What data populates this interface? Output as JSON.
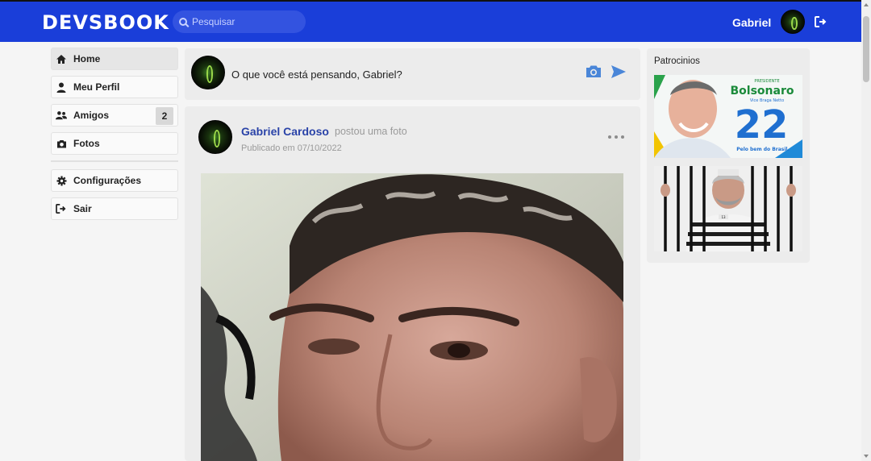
{
  "header": {
    "logo": "DEVSBOOK",
    "search_placeholder": "Pesquisar",
    "user_name": "Gabriel"
  },
  "sidebar": {
    "items": [
      {
        "label": "Home",
        "icon": "home-icon",
        "active": true
      },
      {
        "label": "Meu Perfil",
        "icon": "user-icon"
      },
      {
        "label": "Amigos",
        "icon": "friends-icon",
        "badge": "2"
      },
      {
        "label": "Fotos",
        "icon": "camera-icon"
      }
    ],
    "bottom_items": [
      {
        "label": "Configurações",
        "icon": "gear-icon"
      },
      {
        "label": "Sair",
        "icon": "logout-icon"
      }
    ]
  },
  "composer": {
    "prompt": "O que você está pensando, Gabriel?"
  },
  "post": {
    "author": "Gabriel Cardoso",
    "action": "postou uma foto",
    "date": "Publicado em 07/10/2022"
  },
  "sponsors": {
    "title": "Patrocinios",
    "ad1": {
      "name": "Bolsonaro",
      "subtitle": "Vice Braga Netto",
      "number": "22",
      "slogan": "Pelo bem do Brasil.",
      "label_top": "PRESIDENTE"
    },
    "ad2": {
      "badge": "13"
    }
  },
  "colors": {
    "header_bg": "#1a3ed9",
    "accent_link": "#2a43a8",
    "icon_blue": "#4a86d8"
  }
}
